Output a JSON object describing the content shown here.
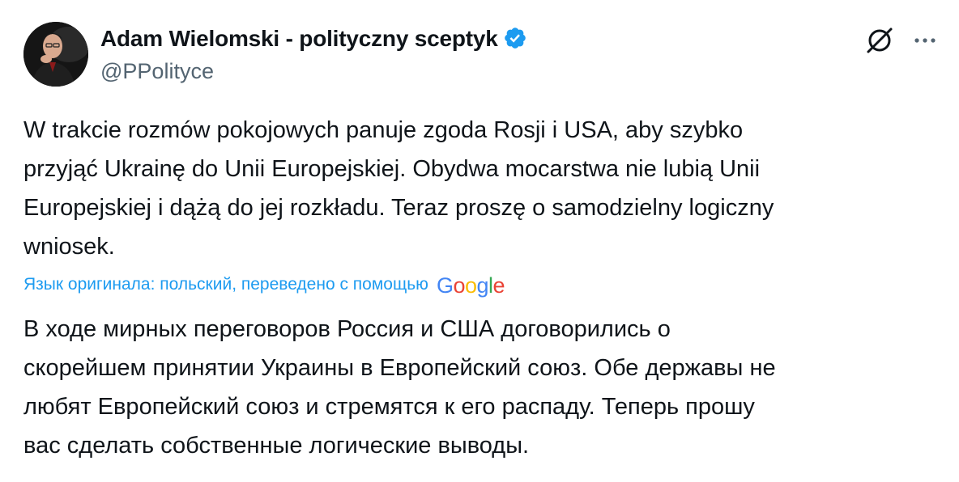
{
  "author": {
    "name": "Adam Wielomski - polityczny sceptyk",
    "handle": "@PPolityce",
    "verified": true
  },
  "icons": {
    "grok": "grok-icon",
    "more": "more-icon",
    "verified": "verified-badge-icon"
  },
  "tweet": {
    "original_text": "W trakcie rozmów pokojowych panuje zgoda Rosji i USA, aby szybko\nprzyjąć Ukrainę do Unii Europejskiej. Obydwa mocarstwa nie lubią Unii\nEuropejskiej i dążą do jej rozkładu. Teraz proszę o samodzielny logiczny\nwniosek.",
    "translation_note": "Язык оригинала: польский, переведено с помощью",
    "translation_provider": "Google",
    "translated_text": "В ходе мирных переговоров Россия и США договорились о\nскорейшем принятии Украины в Европейский союз. Обе державы не\nлюбят Европейский союз и стремятся к его распаду. Теперь прошу\nвас сделать собственные логические выводы."
  },
  "colors": {
    "text": "#0f1419",
    "secondary": "#536471",
    "link": "#1d9bf0",
    "verified": "#1d9bf0",
    "google_blue": "#4285f4",
    "google_red": "#ea4335",
    "google_yellow": "#fbbc05",
    "google_green": "#34a853"
  }
}
